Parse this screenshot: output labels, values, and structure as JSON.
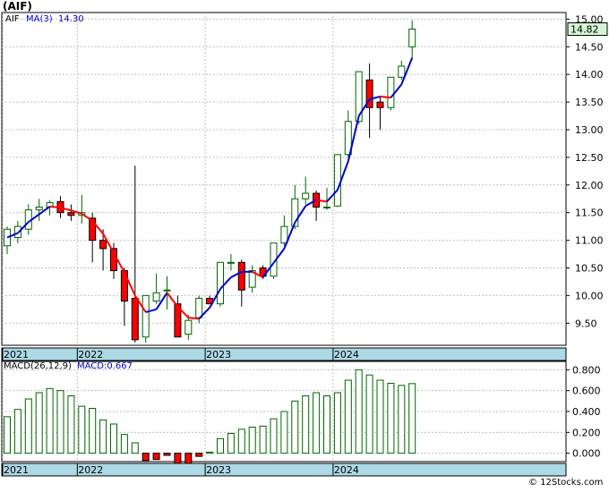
{
  "title": "(AIF)",
  "ticker_label": "AIF",
  "ma_label": "MA(3)",
  "ma_value": "14.30",
  "last_price_label": "14.82",
  "macd_label": "MACD(26,12,9)",
  "macd_value_label": "MACD:0.667",
  "x_ticks": [
    "2021",
    "2022",
    "2023",
    "2024"
  ],
  "watermark": "© 12Stocks.com",
  "colors": {
    "up_fill": "#ffffff",
    "up_stroke": "#006400",
    "down_fill": "#ff0000",
    "wick": "#000000",
    "ma_up": "#0000cc",
    "ma_down": "#ff0000",
    "macd_stroke": "#006400",
    "macd_neg_fill": "#ff0000",
    "axis_band": "#add8e6",
    "grid": "#c0c0c0",
    "tag_fill": "#d4f5d4"
  },
  "chart_data": [
    {
      "type": "candlestick",
      "title": "(AIF)",
      "ylim": [
        9.1,
        15.12
      ],
      "y_ticks": [
        9.5,
        10.0,
        10.5,
        11.0,
        11.5,
        12.0,
        12.5,
        13.0,
        13.5,
        14.0,
        14.5,
        15.0
      ],
      "y_tick_labels": [
        "9.50",
        "10.00",
        "10.50",
        "11.00",
        "11.50",
        "12.00",
        "12.50",
        "13.00",
        "13.50",
        "14.00",
        "14.50",
        "15.00"
      ],
      "grid": true,
      "candles": [
        {
          "open": 10.9,
          "high": 11.25,
          "low": 10.75,
          "close": 11.2
        },
        {
          "open": 11.05,
          "high": 11.35,
          "low": 10.95,
          "close": 11.25
        },
        {
          "open": 11.2,
          "high": 11.65,
          "low": 11.1,
          "close": 11.55
        },
        {
          "open": 11.55,
          "high": 11.75,
          "low": 11.35,
          "close": 11.6
        },
        {
          "open": 11.6,
          "high": 11.72,
          "low": 11.45,
          "close": 11.68
        },
        {
          "open": 11.7,
          "high": 11.8,
          "low": 11.4,
          "close": 11.5
        },
        {
          "open": 11.5,
          "high": 11.65,
          "low": 11.35,
          "close": 11.45
        },
        {
          "open": 11.45,
          "high": 11.82,
          "low": 11.3,
          "close": 11.5
        },
        {
          "open": 11.4,
          "high": 11.5,
          "low": 10.6,
          "close": 11.0
        },
        {
          "open": 11.0,
          "high": 11.2,
          "low": 10.45,
          "close": 10.85
        },
        {
          "open": 10.85,
          "high": 10.95,
          "low": 10.3,
          "close": 10.45
        },
        {
          "open": 10.45,
          "high": 10.5,
          "low": 9.45,
          "close": 9.9
        },
        {
          "open": 9.95,
          "high": 12.35,
          "low": 9.15,
          "close": 9.2
        },
        {
          "open": 9.25,
          "high": 10.0,
          "low": 9.15,
          "close": 10.0
        },
        {
          "open": 9.9,
          "high": 10.4,
          "low": 9.85,
          "close": 10.05
        },
        {
          "open": 10.1,
          "high": 10.35,
          "low": 9.75,
          "close": 10.1
        },
        {
          "open": 9.85,
          "high": 10.0,
          "low": 9.25,
          "close": 9.25
        },
        {
          "open": 9.3,
          "high": 9.65,
          "low": 9.2,
          "close": 9.55
        },
        {
          "open": 9.6,
          "high": 10.0,
          "low": 9.5,
          "close": 9.95
        },
        {
          "open": 9.95,
          "high": 10.0,
          "low": 9.85,
          "close": 9.85
        },
        {
          "open": 9.85,
          "high": 10.6,
          "low": 9.8,
          "close": 10.6
        },
        {
          "open": 10.6,
          "high": 10.75,
          "low": 10.45,
          "close": 10.6
        },
        {
          "open": 10.6,
          "high": 10.65,
          "low": 9.8,
          "close": 10.1
        },
        {
          "open": 10.15,
          "high": 10.55,
          "low": 10.05,
          "close": 10.45
        },
        {
          "open": 10.5,
          "high": 10.55,
          "low": 10.3,
          "close": 10.35
        },
        {
          "open": 10.35,
          "high": 10.95,
          "low": 10.3,
          "close": 10.95
        },
        {
          "open": 10.95,
          "high": 11.45,
          "low": 10.9,
          "close": 11.25
        },
        {
          "open": 11.25,
          "high": 12.0,
          "low": 11.2,
          "close": 11.75
        },
        {
          "open": 11.75,
          "high": 12.15,
          "low": 11.65,
          "close": 11.85
        },
        {
          "open": 11.85,
          "high": 11.9,
          "low": 11.35,
          "close": 11.6
        },
        {
          "open": 11.6,
          "high": 11.95,
          "low": 11.55,
          "close": 11.6
        },
        {
          "open": 11.62,
          "high": 12.55,
          "low": 11.6,
          "close": 12.55
        },
        {
          "open": 12.55,
          "high": 13.35,
          "low": 12.5,
          "close": 13.15
        },
        {
          "open": 13.15,
          "high": 14.05,
          "low": 13.1,
          "close": 14.05
        },
        {
          "open": 13.9,
          "high": 14.2,
          "low": 12.85,
          "close": 13.4
        },
        {
          "open": 13.5,
          "high": 13.6,
          "low": 13.0,
          "close": 13.4
        },
        {
          "open": 13.4,
          "high": 13.95,
          "low": 13.35,
          "close": 13.95
        },
        {
          "open": 13.95,
          "high": 14.25,
          "low": 13.9,
          "close": 14.15
        },
        {
          "open": 14.5,
          "high": 14.98,
          "low": 14.28,
          "close": 14.82
        }
      ],
      "ma3": [
        11.05,
        11.13,
        11.33,
        11.47,
        11.61,
        11.59,
        11.54,
        11.48,
        11.35,
        11.12,
        10.77,
        10.42,
        10.0,
        9.7,
        9.75,
        10.05,
        9.8,
        9.6,
        9.58,
        9.78,
        10.12,
        10.33,
        10.43,
        10.43,
        10.33,
        10.59,
        10.85,
        11.32,
        11.62,
        11.73,
        11.7,
        11.91,
        12.43,
        13.25,
        13.55,
        13.6,
        13.58,
        13.82,
        14.3
      ],
      "x_ticks": [
        {
          "label": "2021",
          "index": 0
        },
        {
          "label": "2022",
          "index": 7
        },
        {
          "label": "2023",
          "index": 19
        },
        {
          "label": "2024",
          "index": 31
        }
      ]
    },
    {
      "type": "bar",
      "title": "MACD(26,12,9)",
      "ylim": [
        -0.08,
        0.88
      ],
      "y_ticks": [
        0.0,
        0.2,
        0.4,
        0.6,
        0.8
      ],
      "y_tick_labels": [
        "0.000",
        "0.200",
        "0.400",
        "0.600",
        "0.800"
      ],
      "grid": true,
      "values": [
        0.35,
        0.42,
        0.52,
        0.58,
        0.62,
        0.6,
        0.55,
        0.45,
        0.43,
        0.32,
        0.28,
        0.18,
        0.1,
        -0.07,
        -0.06,
        -0.02,
        -0.1,
        -0.11,
        -0.03,
        0.01,
        0.14,
        0.19,
        0.23,
        0.25,
        0.26,
        0.33,
        0.4,
        0.5,
        0.55,
        0.58,
        0.55,
        0.58,
        0.7,
        0.8,
        0.75,
        0.7,
        0.67,
        0.65,
        0.667
      ]
    }
  ]
}
